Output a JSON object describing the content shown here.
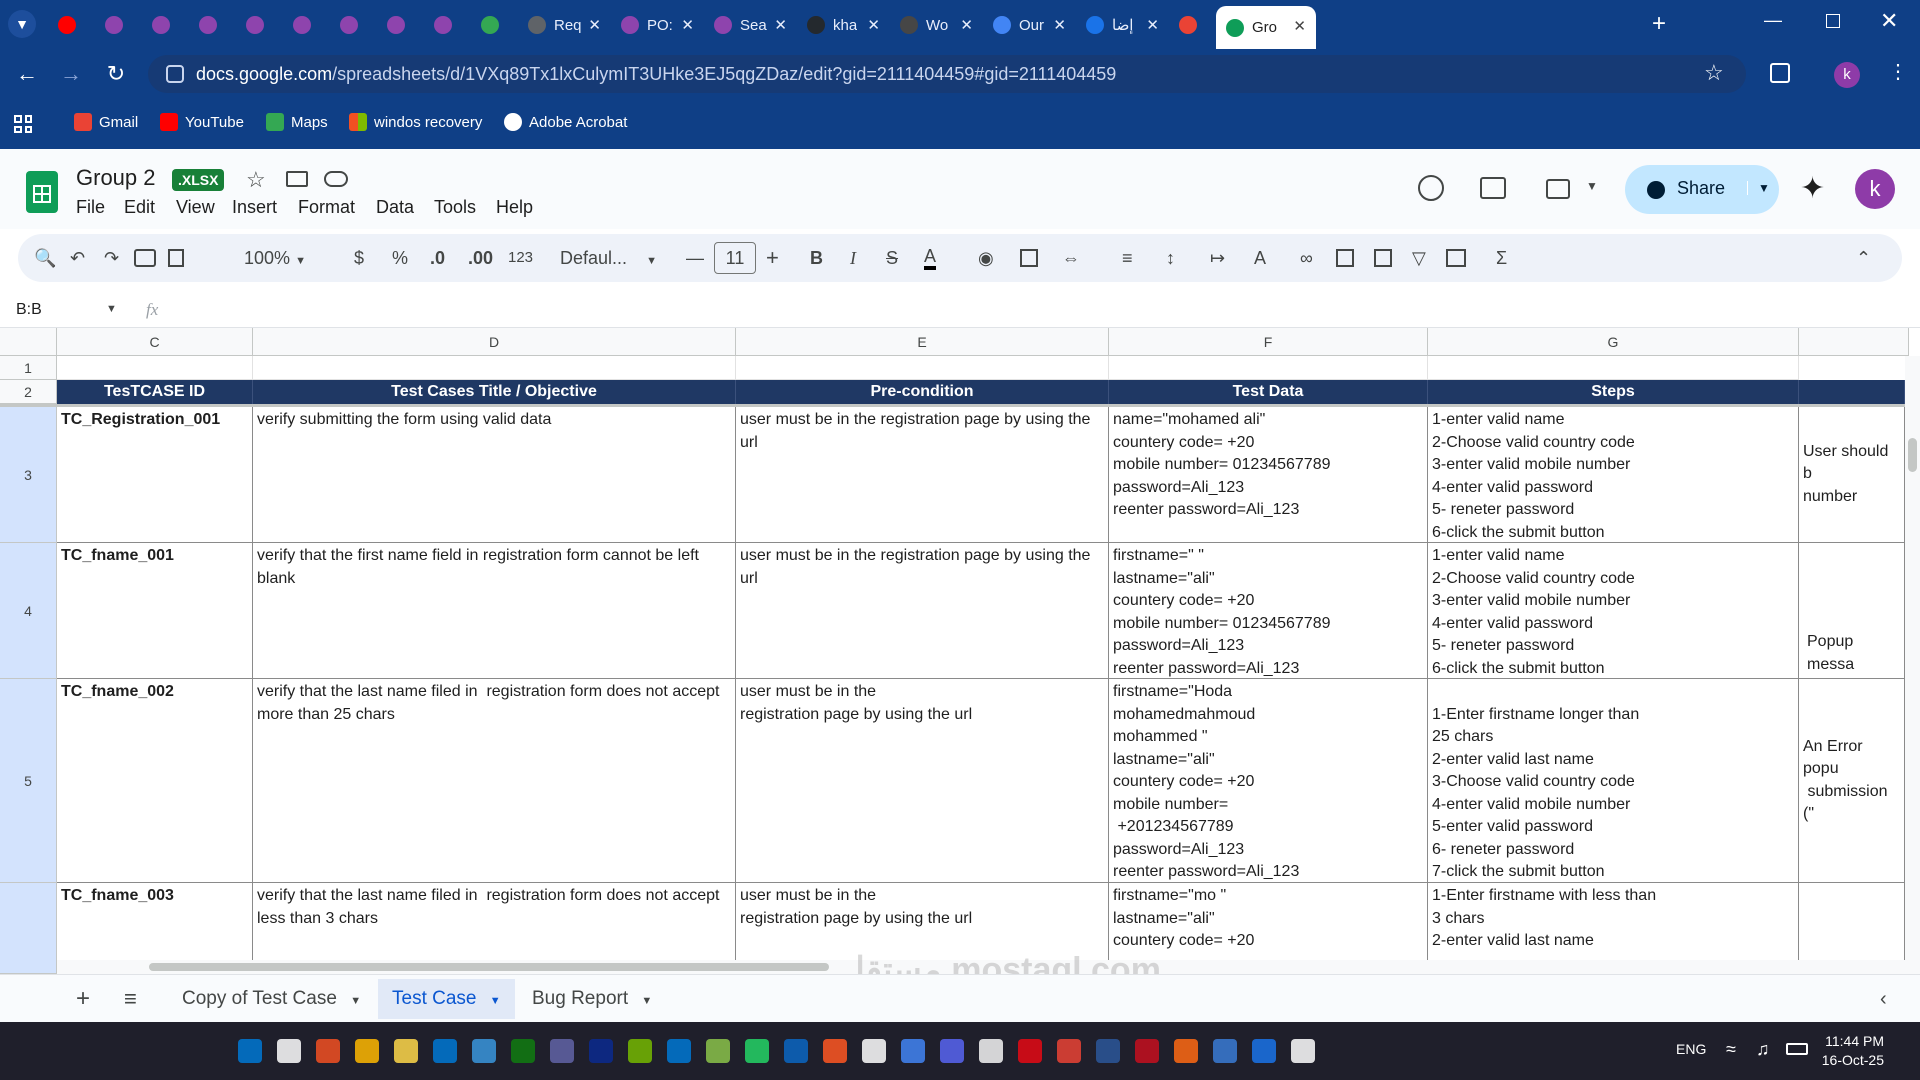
{
  "browser": {
    "tabs": [
      {
        "title": "",
        "icon": "youtube-icon",
        "color": "#ff0000"
      },
      {
        "title": "",
        "icon": "shield-icon",
        "color": "#8e44ad"
      },
      {
        "title": "",
        "icon": "shield-icon",
        "color": "#8e44ad"
      },
      {
        "title": "",
        "icon": "shield-icon",
        "color": "#8e44ad"
      },
      {
        "title": "",
        "icon": "shield-icon",
        "color": "#8e44ad"
      },
      {
        "title": "",
        "icon": "shield-icon",
        "color": "#8e44ad"
      },
      {
        "title": "",
        "icon": "shield-icon",
        "color": "#8e44ad"
      },
      {
        "title": "",
        "icon": "shield-icon",
        "color": "#8e44ad"
      },
      {
        "title": "",
        "icon": "shield-icon",
        "color": "#8e44ad"
      },
      {
        "title": "",
        "icon": "drive-icon",
        "color": "#34a853"
      },
      {
        "title": "Req",
        "icon": "page-icon",
        "color": "#5f6368"
      },
      {
        "title": "PO:",
        "icon": "shield-icon",
        "color": "#8e44ad"
      },
      {
        "title": "Sea",
        "icon": "shield-icon",
        "color": "#8e44ad"
      },
      {
        "title": "kha",
        "icon": "github-icon",
        "color": "#24292e"
      },
      {
        "title": "Wo",
        "icon": "wordpress-icon",
        "color": "#464646"
      },
      {
        "title": "Our",
        "icon": "doc-icon",
        "color": "#4285f4"
      },
      {
        "title": "إضا",
        "icon": "circle-icon",
        "color": "#1a73e8"
      },
      {
        "title": "",
        "icon": "record-icon",
        "color": "#ea4335"
      },
      {
        "title": "Gro",
        "icon": "sheets-icon",
        "color": "#0f9d58"
      }
    ],
    "url_host": "docs.google.com",
    "url_path": "/spreadsheets/d/1VXq89Tx1lxCulymIT3UHke3EJ5qgZDaz/edit?gid=2111404459#gid=2111404459",
    "profile_initial": "k",
    "bookmarks": [
      {
        "label": "Gmail",
        "color": "#ea4335"
      },
      {
        "label": "YouTube",
        "color": "#ff0000"
      },
      {
        "label": "Maps",
        "color": "#34a853"
      },
      {
        "label": "windos recovery",
        "color": "#fbbc04"
      },
      {
        "label": "Adobe Acrobat",
        "color": "#ffffff"
      }
    ]
  },
  "sheets": {
    "title": "Group 2",
    "badge": ".XLSX",
    "menus": [
      "File",
      "Edit",
      "View",
      "Insert",
      "Format",
      "Data",
      "Tools",
      "Help"
    ],
    "share_label": "Share",
    "avatar_initial": "k",
    "toolbar": {
      "zoom": "100%",
      "currency": "$",
      "percent": "%",
      "dec_less": ".0",
      "dec_more": ".00",
      "number_format": "123",
      "font": "Defaul...",
      "font_size": "11"
    },
    "name_box": "B:B",
    "fx": "fx"
  },
  "grid": {
    "columns": [
      "C",
      "D",
      "E",
      "F",
      "G"
    ],
    "row_numbers": [
      "1",
      "2",
      "3",
      "4",
      "5"
    ],
    "headers": [
      "TesTCASE ID",
      "Test Cases Title / Objective",
      "Pre-condition",
      "Test Data",
      "Steps"
    ],
    "rows": [
      {
        "id": "TC_Registration_001",
        "title": "verify submitting the form using valid data",
        "pre": "user must be in the registration page by using the url",
        "data": "name=\"mohamed ali\"\ncountery code= +20\nmobile number= 01234567789\npassword=Ali_123\nreenter password=Ali_123",
        "steps": "1-enter valid name\n2-Choose valid country code\n3-enter valid mobile number\n4-enter valid password\n5- reneter password\n6-click the submit button",
        "expected": "User should b\nnumber"
      },
      {
        "id": "TC_fname_001",
        "title": "verify that the first name field in registration form cannot be left blank",
        "pre": "user must be in the registration page by using the url",
        "data": "firstname=\" \"\nlastname=\"ali\"\ncountery code= +20\nmobile number= 01234567789\npassword=Ali_123\nreenter password=Ali_123",
        "steps": "1-enter valid name\n2-Choose valid country code\n3-enter valid mobile number\n4-enter valid password\n5- reneter password\n6-click the submit button",
        "expected": "Popup messa"
      },
      {
        "id": "TC_fname_002",
        "title": "verify that the last name filed in  registration form does not accept more than 25 chars",
        "pre": "user must be in the\nregistration page by using the url",
        "data": "firstname=\"Hoda\nmohamedmahmoud\nmohammed \"\nlastname=\"ali\"\ncountery code= +20\nmobile number=\n +201234567789\npassword=Ali_123\nreenter password=Ali_123",
        "steps": "\n1-Enter firstname longer than\n25 chars\n2-enter valid last name\n3-Choose valid country code\n4-enter valid mobile number\n5-enter valid password\n6- reneter password\n7-click the submit button",
        "expected": "An Error popu\n submission (\""
      },
      {
        "id": "TC_fname_003",
        "title": "verify that the last name filed in  registration form does not accept less than 3 chars",
        "pre": "user must be in the\nregistration page by using the url",
        "data": "firstname=\"mo \"\nlastname=\"ali\"\ncountery code= +20",
        "steps": "1-Enter firstname with less than\n3 chars\n2-enter valid last name",
        "expected": ""
      }
    ],
    "row_labels": [
      "3",
      "4",
      "5",
      ""
    ]
  },
  "sheet_tabs": [
    "Copy of Test Case",
    "Test Case",
    "Bug Report"
  ],
  "watermark": "مستقل mostaql.com",
  "taskbar": {
    "lang": "ENG",
    "time": "11:44 PM",
    "date": "16-Oct-25"
  }
}
